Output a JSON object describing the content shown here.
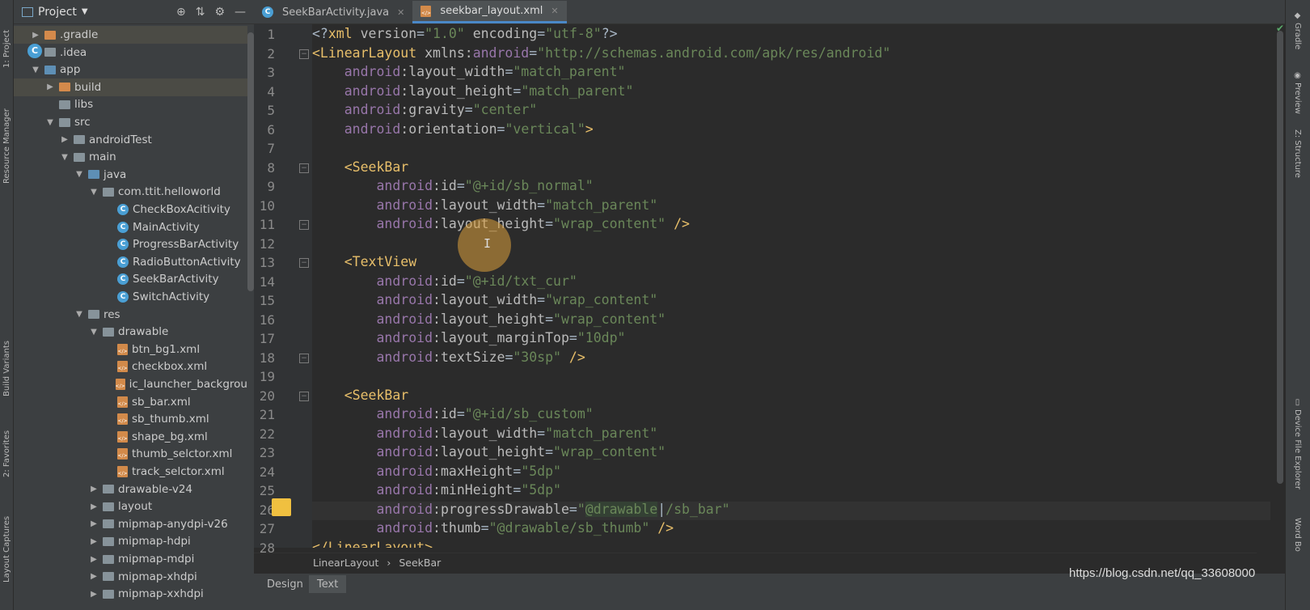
{
  "left_strip": {
    "project": "1: Project",
    "resource_manager": "Resource Manager",
    "build_variants": "Build Variants",
    "favorites": "2: Favorites",
    "layout_captures": "Layout Captures"
  },
  "right_strip": {
    "gradle": "Gradle",
    "preview": "Preview",
    "structure": "Z: Structure",
    "device_file_explorer": "Device File Explorer",
    "word_book": "Word Bo"
  },
  "project_panel": {
    "title": "Project",
    "tree": [
      {
        "label": ".gradle",
        "depth": 1,
        "arrow": "right",
        "icon": "folder-orange",
        "selected": true
      },
      {
        "label": ".idea",
        "depth": 1,
        "arrow": "right",
        "icon": "folder"
      },
      {
        "label": "app",
        "depth": 1,
        "arrow": "down",
        "icon": "folder-blue"
      },
      {
        "label": "build",
        "depth": 2,
        "arrow": "right",
        "icon": "folder-orange",
        "selected": true
      },
      {
        "label": "libs",
        "depth": 2,
        "arrow": "",
        "icon": "folder"
      },
      {
        "label": "src",
        "depth": 2,
        "arrow": "down",
        "icon": "folder"
      },
      {
        "label": "androidTest",
        "depth": 3,
        "arrow": "right",
        "icon": "folder"
      },
      {
        "label": "main",
        "depth": 3,
        "arrow": "down",
        "icon": "folder"
      },
      {
        "label": "java",
        "depth": 4,
        "arrow": "down",
        "icon": "folder-blue"
      },
      {
        "label": "com.ttit.helloworld",
        "depth": 5,
        "arrow": "down",
        "icon": "folder"
      },
      {
        "label": "CheckBoxAcitivity",
        "depth": 6,
        "arrow": "",
        "icon": "class"
      },
      {
        "label": "MainActivity",
        "depth": 6,
        "arrow": "",
        "icon": "class"
      },
      {
        "label": "ProgressBarActivity",
        "depth": 6,
        "arrow": "",
        "icon": "class"
      },
      {
        "label": "RadioButtonActivity",
        "depth": 6,
        "arrow": "",
        "icon": "class"
      },
      {
        "label": "SeekBarActivity",
        "depth": 6,
        "arrow": "",
        "icon": "class"
      },
      {
        "label": "SwitchActivity",
        "depth": 6,
        "arrow": "",
        "icon": "class"
      },
      {
        "label": "res",
        "depth": 4,
        "arrow": "down",
        "icon": "folder"
      },
      {
        "label": "drawable",
        "depth": 5,
        "arrow": "down",
        "icon": "folder"
      },
      {
        "label": "btn_bg1.xml",
        "depth": 6,
        "arrow": "",
        "icon": "xml"
      },
      {
        "label": "checkbox.xml",
        "depth": 6,
        "arrow": "",
        "icon": "xml"
      },
      {
        "label": "ic_launcher_backgrou",
        "depth": 6,
        "arrow": "",
        "icon": "xml"
      },
      {
        "label": "sb_bar.xml",
        "depth": 6,
        "arrow": "",
        "icon": "xml"
      },
      {
        "label": "sb_thumb.xml",
        "depth": 6,
        "arrow": "",
        "icon": "xml"
      },
      {
        "label": "shape_bg.xml",
        "depth": 6,
        "arrow": "",
        "icon": "xml"
      },
      {
        "label": "thumb_selctor.xml",
        "depth": 6,
        "arrow": "",
        "icon": "xml"
      },
      {
        "label": "track_selctor.xml",
        "depth": 6,
        "arrow": "",
        "icon": "xml"
      },
      {
        "label": "drawable-v24",
        "depth": 5,
        "arrow": "right",
        "icon": "folder"
      },
      {
        "label": "layout",
        "depth": 5,
        "arrow": "right",
        "icon": "folder"
      },
      {
        "label": "mipmap-anydpi-v26",
        "depth": 5,
        "arrow": "right",
        "icon": "folder"
      },
      {
        "label": "mipmap-hdpi",
        "depth": 5,
        "arrow": "right",
        "icon": "folder"
      },
      {
        "label": "mipmap-mdpi",
        "depth": 5,
        "arrow": "right",
        "icon": "folder"
      },
      {
        "label": "mipmap-xhdpi",
        "depth": 5,
        "arrow": "right",
        "icon": "folder"
      },
      {
        "label": "mipmap-xxhdpi",
        "depth": 5,
        "arrow": "right",
        "icon": "folder"
      }
    ]
  },
  "editor": {
    "tabs": [
      {
        "label": "SeekBarActivity.java",
        "icon": "class",
        "active": false
      },
      {
        "label": "seekbar_layout.xml",
        "icon": "xml",
        "active": true
      }
    ],
    "code_lines": [
      [
        [
          "pun",
          "<?"
        ],
        [
          "tag",
          "xml "
        ],
        [
          "attr",
          "version"
        ],
        [
          "pun",
          "="
        ],
        [
          "val",
          "\"1.0\" "
        ],
        [
          "attr",
          "encoding"
        ],
        [
          "pun",
          "="
        ],
        [
          "val",
          "\"utf-8\""
        ],
        [
          "pun",
          "?>"
        ]
      ],
      [
        [
          "tag",
          "<LinearLayout "
        ],
        [
          "attr",
          "xmlns:"
        ],
        [
          "ns",
          "android"
        ],
        [
          "pun",
          "="
        ],
        [
          "val",
          "\"http://schemas.android.com/apk/res/android\""
        ]
      ],
      [
        [
          "pun",
          "    "
        ],
        [
          "ns",
          "android"
        ],
        [
          "attr",
          ":layout_width"
        ],
        [
          "pun",
          "="
        ],
        [
          "val",
          "\"match_parent\""
        ]
      ],
      [
        [
          "pun",
          "    "
        ],
        [
          "ns",
          "android"
        ],
        [
          "attr",
          ":layout_height"
        ],
        [
          "pun",
          "="
        ],
        [
          "val",
          "\"match_parent\""
        ]
      ],
      [
        [
          "pun",
          "    "
        ],
        [
          "ns",
          "android"
        ],
        [
          "attr",
          ":gravity"
        ],
        [
          "pun",
          "="
        ],
        [
          "val",
          "\"center\""
        ]
      ],
      [
        [
          "pun",
          "    "
        ],
        [
          "ns",
          "android"
        ],
        [
          "attr",
          ":orientation"
        ],
        [
          "pun",
          "="
        ],
        [
          "val",
          "\"vertical\""
        ],
        [
          "tag",
          ">"
        ]
      ],
      [],
      [
        [
          "pun",
          "    "
        ],
        [
          "tag",
          "<SeekBar"
        ]
      ],
      [
        [
          "pun",
          "        "
        ],
        [
          "ns",
          "android"
        ],
        [
          "attr",
          ":id"
        ],
        [
          "pun",
          "="
        ],
        [
          "val",
          "\"@+id/sb_normal\""
        ]
      ],
      [
        [
          "pun",
          "        "
        ],
        [
          "ns",
          "android"
        ],
        [
          "attr",
          ":layout_width"
        ],
        [
          "pun",
          "="
        ],
        [
          "val",
          "\"match_parent\""
        ]
      ],
      [
        [
          "pun",
          "        "
        ],
        [
          "ns",
          "android"
        ],
        [
          "attr",
          ":layout_height"
        ],
        [
          "pun",
          "="
        ],
        [
          "val",
          "\"wrap_content\" "
        ],
        [
          "tag",
          "/>"
        ]
      ],
      [],
      [
        [
          "pun",
          "    "
        ],
        [
          "tag",
          "<TextView"
        ]
      ],
      [
        [
          "pun",
          "        "
        ],
        [
          "ns",
          "android"
        ],
        [
          "attr",
          ":id"
        ],
        [
          "pun",
          "="
        ],
        [
          "val",
          "\"@+id/txt_cur\""
        ]
      ],
      [
        [
          "pun",
          "        "
        ],
        [
          "ns",
          "android"
        ],
        [
          "attr",
          ":layout_width"
        ],
        [
          "pun",
          "="
        ],
        [
          "val",
          "\"wrap_content\""
        ]
      ],
      [
        [
          "pun",
          "        "
        ],
        [
          "ns",
          "android"
        ],
        [
          "attr",
          ":layout_height"
        ],
        [
          "pun",
          "="
        ],
        [
          "val",
          "\"wrap_content\""
        ]
      ],
      [
        [
          "pun",
          "        "
        ],
        [
          "ns",
          "android"
        ],
        [
          "attr",
          ":layout_marginTop"
        ],
        [
          "pun",
          "="
        ],
        [
          "val",
          "\"10dp\""
        ]
      ],
      [
        [
          "pun",
          "        "
        ],
        [
          "ns",
          "android"
        ],
        [
          "attr",
          ":textSize"
        ],
        [
          "pun",
          "="
        ],
        [
          "val",
          "\"30sp\" "
        ],
        [
          "tag",
          "/>"
        ]
      ],
      [],
      [
        [
          "pun",
          "    "
        ],
        [
          "tag",
          "<SeekBar"
        ]
      ],
      [
        [
          "pun",
          "        "
        ],
        [
          "ns",
          "android"
        ],
        [
          "attr",
          ":id"
        ],
        [
          "pun",
          "="
        ],
        [
          "val",
          "\"@+id/sb_custom\""
        ]
      ],
      [
        [
          "pun",
          "        "
        ],
        [
          "ns",
          "android"
        ],
        [
          "attr",
          ":layout_width"
        ],
        [
          "pun",
          "="
        ],
        [
          "val",
          "\"match_parent\""
        ]
      ],
      [
        [
          "pun",
          "        "
        ],
        [
          "ns",
          "android"
        ],
        [
          "attr",
          ":layout_height"
        ],
        [
          "pun",
          "="
        ],
        [
          "val",
          "\"wrap_content\""
        ]
      ],
      [
        [
          "pun",
          "        "
        ],
        [
          "ns",
          "android"
        ],
        [
          "attr",
          ":maxHeight"
        ],
        [
          "pun",
          "="
        ],
        [
          "val",
          "\"5dp\""
        ]
      ],
      [
        [
          "pun",
          "        "
        ],
        [
          "ns",
          "android"
        ],
        [
          "attr",
          ":minHeight"
        ],
        [
          "pun",
          "="
        ],
        [
          "val",
          "\"5dp\""
        ]
      ],
      [
        [
          "pun",
          "        "
        ],
        [
          "ns",
          "android"
        ],
        [
          "attr",
          ":progressDrawable"
        ],
        [
          "pun",
          "="
        ],
        [
          "val",
          "\""
        ],
        [
          "hl",
          "@drawable"
        ],
        [
          "pun",
          "|"
        ],
        [
          "val",
          "/sb_bar\""
        ]
      ],
      [
        [
          "pun",
          "        "
        ],
        [
          "ns",
          "android"
        ],
        [
          "attr",
          ":thumb"
        ],
        [
          "pun",
          "="
        ],
        [
          "val",
          "\"@drawable/sb_thumb\" "
        ],
        [
          "tag",
          "/>"
        ]
      ],
      [
        [
          "tag",
          "</LinearLayout>"
        ]
      ]
    ],
    "current_line": 26,
    "breadcrumb": [
      "LinearLayout",
      "SeekBar"
    ],
    "bottom_tabs": [
      "Design",
      "Text"
    ],
    "active_bottom_tab": "Text"
  },
  "watermark": "https://blog.csdn.net/qq_33608000"
}
